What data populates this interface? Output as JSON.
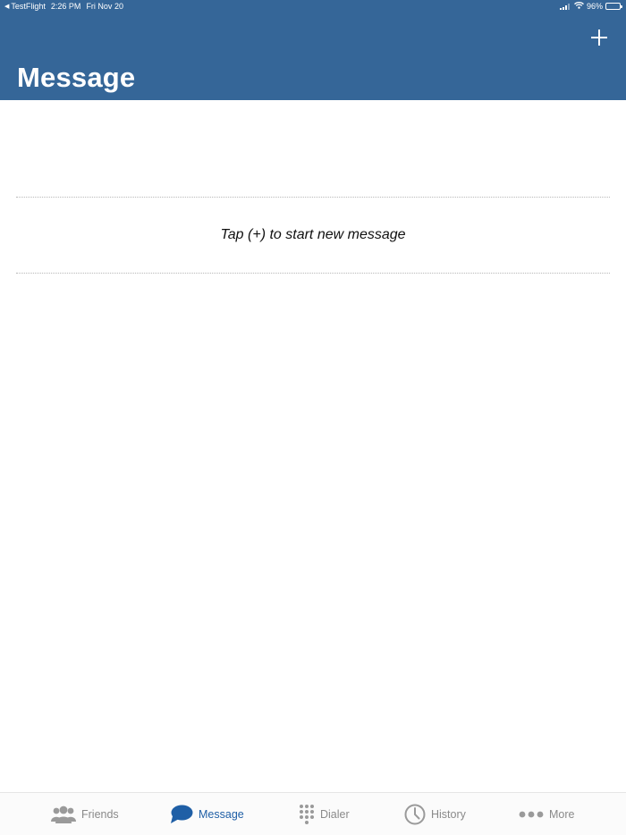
{
  "status_bar": {
    "back_app": "TestFlight",
    "time": "2:26 PM",
    "date": "Fri Nov 20",
    "battery_percent": "96%",
    "battery_level": 0.96
  },
  "header": {
    "title": "Message",
    "background_color": "#356698",
    "add_icon": "plus-icon"
  },
  "main": {
    "empty_hint": "Tap (+) to start new message"
  },
  "tab_bar": {
    "active_color": "#1f5fa6",
    "inactive_color": "#8a8a8a",
    "tabs": [
      {
        "label": "Friends",
        "icon": "friends-icon",
        "active": false
      },
      {
        "label": "Message",
        "icon": "message-bubble-icon",
        "active": true
      },
      {
        "label": "Dialer",
        "icon": "dialpad-icon",
        "active": false
      },
      {
        "label": "History",
        "icon": "clock-icon",
        "active": false
      },
      {
        "label": "More",
        "icon": "more-dots-icon",
        "active": false
      }
    ]
  }
}
